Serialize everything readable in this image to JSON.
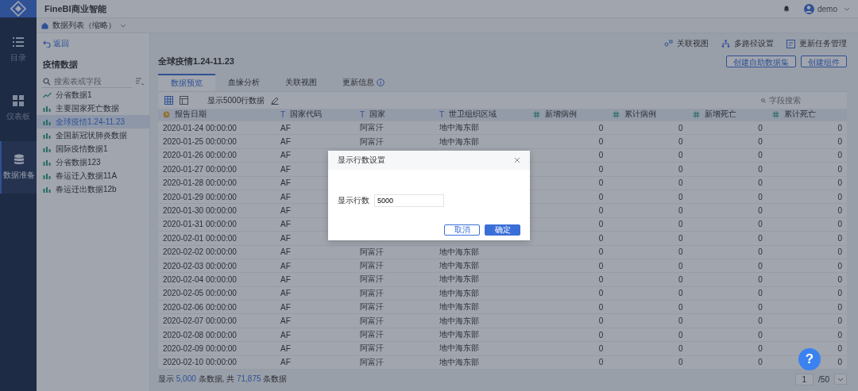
{
  "app": {
    "title": "FineBI商业智能",
    "user": "demo"
  },
  "breadcrumb": "数据列表（缩略）",
  "back": "返回",
  "nav": [
    {
      "label": "目录",
      "kind": "list",
      "selected": false
    },
    {
      "label": "仪表板",
      "kind": "grid",
      "selected": false
    },
    {
      "label": "数据准备",
      "kind": "database",
      "selected": true
    }
  ],
  "panel": {
    "title": "疫情数据",
    "search": {
      "placeholder": "搜索表或字段"
    },
    "items": [
      {
        "label": "分省数据1",
        "kind": "line",
        "selected": false
      },
      {
        "label": "主要国家死亡数据",
        "kind": "table",
        "selected": false
      },
      {
        "label": "全球疫情1.24-11.23",
        "kind": "table",
        "selected": true
      },
      {
        "label": "全国新冠状肺炎数据",
        "kind": "table",
        "selected": false
      },
      {
        "label": "国际疫情数据1",
        "kind": "table",
        "selected": false
      },
      {
        "label": "分省数据123",
        "kind": "table",
        "selected": false
      },
      {
        "label": "春运迁入数据11A",
        "kind": "table",
        "selected": false
      },
      {
        "label": "春运迁出数据12b",
        "kind": "table",
        "selected": false
      }
    ]
  },
  "actions": [
    {
      "label": "关联视图",
      "kind": "relation"
    },
    {
      "label": "多路径设置",
      "kind": "tree"
    },
    {
      "label": "更新任务管理",
      "kind": "task"
    }
  ],
  "title": "全球疫情1.24-11.23",
  "buttons": [
    "创建自助数据集",
    "创建组件"
  ],
  "tabs": [
    {
      "label": "数据预览",
      "selected": true,
      "info": false
    },
    {
      "label": "血缘分析",
      "selected": false,
      "info": false
    },
    {
      "label": "关联视图",
      "selected": false,
      "info": false
    },
    {
      "label": "更新信息",
      "selected": false,
      "info": true
    }
  ],
  "toolbar": {
    "rows_label": "显示5000行数据",
    "search": {
      "placeholder": "字段搜索"
    }
  },
  "table": {
    "columns": [
      {
        "label": "报告日期",
        "kind": "date"
      },
      {
        "label": "国家代码",
        "kind": "text",
        "icon": "T"
      },
      {
        "label": "国家",
        "kind": "text",
        "icon": "T"
      },
      {
        "label": "世卫组织区域",
        "kind": "text",
        "icon": "T"
      },
      {
        "label": "新增病例",
        "kind": "number"
      },
      {
        "label": "累计病例",
        "kind": "number"
      },
      {
        "label": "新增死亡",
        "kind": "number"
      },
      {
        "label": "累计死亡",
        "kind": "number"
      }
    ],
    "rows": [
      [
        "2020-01-24 00:00:00",
        "AF",
        "阿富汗",
        "地中海东部",
        "0",
        "0",
        "0",
        "0"
      ],
      [
        "2020-01-25 00:00:00",
        "AF",
        "阿富汗",
        "地中海东部",
        "0",
        "0",
        "0",
        "0"
      ],
      [
        "2020-01-26 00:00:00",
        "AF",
        null,
        null,
        "0",
        "0",
        "0",
        "0"
      ],
      [
        "2020-01-27 00:00:00",
        "AF",
        null,
        null,
        "0",
        "0",
        "0",
        "0"
      ],
      [
        "2020-01-28 00:00:00",
        "AF",
        null,
        null,
        "0",
        "0",
        "0",
        "0"
      ],
      [
        "2020-01-29 00:00:00",
        "AF",
        null,
        null,
        "0",
        "0",
        "0",
        "0"
      ],
      [
        "2020-01-30 00:00:00",
        "AF",
        null,
        null,
        "0",
        "0",
        "0",
        "0"
      ],
      [
        "2020-01-31 00:00:00",
        "AF",
        null,
        null,
        "0",
        "0",
        "0",
        "0"
      ],
      [
        "2020-02-01 00:00:00",
        "AF",
        null,
        null,
        "0",
        "0",
        "0",
        "0"
      ],
      [
        "2020-02-02 00:00:00",
        "AF",
        "阿富汗",
        "地中海东部",
        "0",
        "0",
        "0",
        "0"
      ],
      [
        "2020-02-03 00:00:00",
        "AF",
        "阿富汗",
        "地中海东部",
        "0",
        "0",
        "0",
        "0"
      ],
      [
        "2020-02-04 00:00:00",
        "AF",
        "阿富汗",
        "地中海东部",
        "0",
        "0",
        "0",
        "0"
      ],
      [
        "2020-02-05 00:00:00",
        "AF",
        "阿富汗",
        "地中海东部",
        "0",
        "0",
        "0",
        "0"
      ],
      [
        "2020-02-06 00:00:00",
        "AF",
        "阿富汗",
        "地中海东部",
        "0",
        "0",
        "0",
        "0"
      ],
      [
        "2020-02-07 00:00:00",
        "AF",
        "阿富汗",
        "地中海东部",
        "0",
        "0",
        "0",
        "0"
      ],
      [
        "2020-02-08 00:00:00",
        "AF",
        "阿富汗",
        "地中海东部",
        "0",
        "0",
        "0",
        "0"
      ],
      [
        "2020-02-09 00:00:00",
        "AF",
        "阿富汗",
        "地中海东部",
        "0",
        "0",
        "0",
        "0"
      ],
      [
        "2020-02-10 00:00:00",
        "AF",
        "阿富汗",
        "地中海东部",
        "0",
        "0",
        "0",
        "0"
      ]
    ]
  },
  "footer": {
    "prefix": "显示",
    "shown": "5,000",
    "middle": "条数据, 共",
    "total": "71,875",
    "suffix": "条数据"
  },
  "pagination": {
    "page": "1",
    "pages": "/50"
  },
  "help": "?",
  "dialog": {
    "title": "显示行数设置",
    "field_label": "显示行数",
    "value": "5000",
    "buttons": [
      {
        "label": "取消",
        "kind": "secondary"
      },
      {
        "label": "确定",
        "kind": "primary"
      }
    ]
  }
}
